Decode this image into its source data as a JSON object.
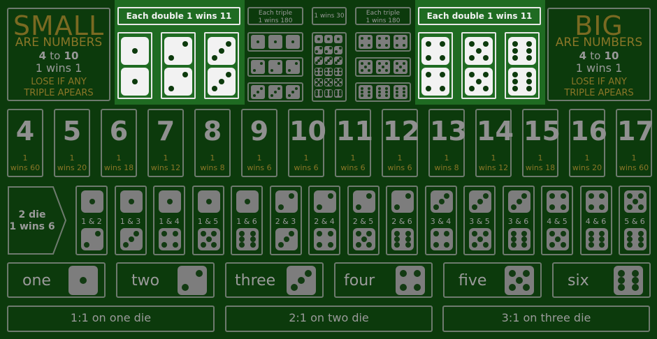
{
  "small": {
    "title": "SMALL",
    "sub": "ARE NUMBERS",
    "range_a": "4",
    "range_to": "to",
    "range_b": "10",
    "odds": "1 wins 1",
    "lose1": "LOSE IF ANY",
    "lose2": "TRIPLE APEARS"
  },
  "big": {
    "title": "BIG",
    "sub": "ARE NUMBERS",
    "range_a": "4",
    "range_to": "to",
    "range_b": "10",
    "odds": "1 wins 1",
    "lose1": "LOSE IF ANY",
    "lose2": "TRIPLE APEARS"
  },
  "doubles_left_label": "Each double 1 wins 11",
  "doubles_right_label": "Each double 1 wins 11",
  "triple_left_l1": "Each triple",
  "triple_left_l2": "1 wins 180",
  "any_triple": "1 wins 30",
  "triple_right_l1": "Each triple",
  "triple_right_l2": "1 wins 180",
  "totals": [
    {
      "n": "4",
      "p1": "1",
      "p2": "wins 60"
    },
    {
      "n": "5",
      "p1": "1",
      "p2": "wins 20"
    },
    {
      "n": "6",
      "p1": "1",
      "p2": "wins 18"
    },
    {
      "n": "7",
      "p1": "1",
      "p2": "wins 12"
    },
    {
      "n": "8",
      "p1": "1",
      "p2": "wins 8"
    },
    {
      "n": "9",
      "p1": "1",
      "p2": "wins 6"
    },
    {
      "n": "10",
      "p1": "1",
      "p2": "wins 6"
    },
    {
      "n": "11",
      "p1": "1",
      "p2": "wins 6"
    },
    {
      "n": "12",
      "p1": "1",
      "p2": "wins 6"
    },
    {
      "n": "13",
      "p1": "1",
      "p2": "wins 8"
    },
    {
      "n": "14",
      "p1": "1",
      "p2": "wins 12"
    },
    {
      "n": "15",
      "p1": "1",
      "p2": "wins 18"
    },
    {
      "n": "16",
      "p1": "1",
      "p2": "wins 20"
    },
    {
      "n": "17",
      "p1": "1",
      "p2": "wins 60"
    }
  ],
  "two_die": {
    "l1": "2 die",
    "l2": "1 wins 6"
  },
  "pairs": [
    "1 & 2",
    "1 & 3",
    "1 & 4",
    "1 & 5",
    "1 & 6",
    "2 & 3",
    "2 & 4",
    "2 & 5",
    "2 & 6",
    "3 & 4",
    "3 & 5",
    "3 & 6",
    "4 & 5",
    "4 & 6",
    "5 & 6"
  ],
  "singles": [
    "one",
    "two",
    "three",
    "four",
    "five",
    "six"
  ],
  "bottom": [
    "1:1 on one die",
    "2:1 on two die",
    "3:1 on three die"
  ],
  "colors": {
    "felt": "#0c3a0c",
    "highlight": "#1f6b22",
    "gold": "#8a7628"
  }
}
